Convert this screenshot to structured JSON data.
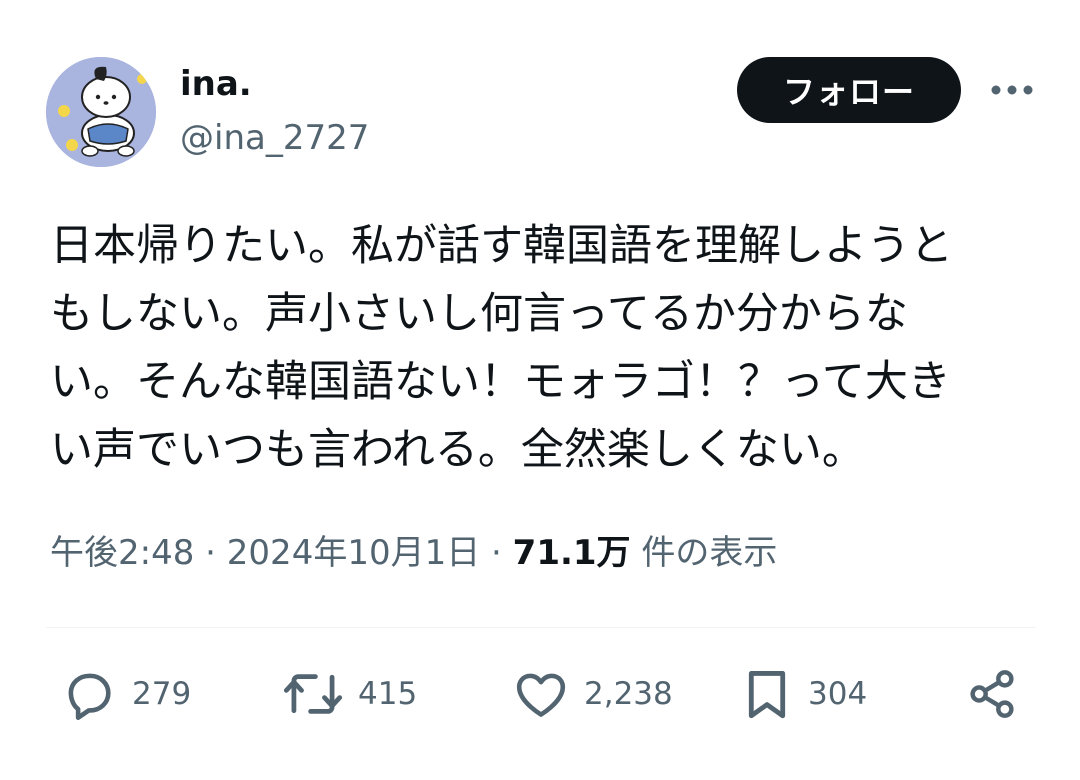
{
  "user": {
    "display_name": "ina.",
    "handle": "@ina_2727",
    "avatar_icon": "pochacco-avatar"
  },
  "header": {
    "follow_label": "フォロー",
    "more_icon": "more-dots-icon"
  },
  "tweet": {
    "lines": [
      "日本帰りたい。私が話す韓国語を理解しようと",
      "もしない。声小さいし何言ってるか分からな",
      "い。そんな韓国語ない！モォラゴ！？って大き",
      "い声でいつも言われる。全然楽しくない。"
    ]
  },
  "meta": {
    "time": "午後2:48",
    "separator": "·",
    "date": "2024年10月1日",
    "views_count": "71.1万",
    "views_label": "件の表示"
  },
  "actions": {
    "replies": "279",
    "reposts": "415",
    "likes": "2,238",
    "bookmarks": "304"
  },
  "colors": {
    "text": "#0f1419",
    "secondary": "#536471",
    "follow_bg": "#0f1419",
    "avatar_bg": "#a9b4df"
  }
}
